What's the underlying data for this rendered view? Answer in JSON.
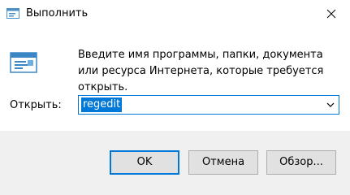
{
  "window": {
    "title": "Выполнить",
    "icon": "run-dialog-icon",
    "close_icon": "close-icon"
  },
  "main": {
    "description": "Введите имя программы, папки, документа или ресурса Интернета, которые требуется открыть.",
    "open_label": "Открыть:",
    "combo_value": "regedit",
    "combo_arrow_icon": "chevron-down-icon"
  },
  "buttons": {
    "ok": "OK",
    "cancel": "Отмена",
    "browse": "Обзор..."
  },
  "colors": {
    "accent": "#0078d7",
    "footer_bg": "#f0f0f0",
    "button_bg": "#e1e1e1",
    "button_border": "#adadad"
  }
}
